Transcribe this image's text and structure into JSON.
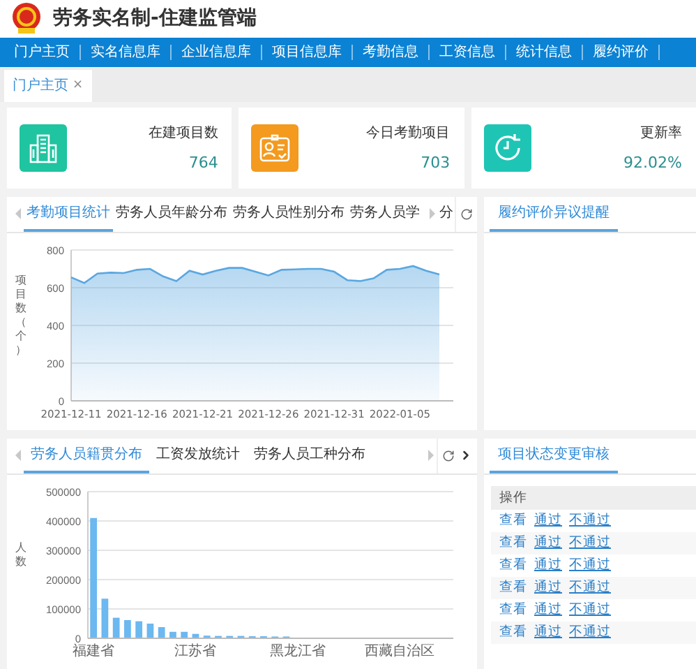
{
  "header": {
    "title": "劳务实名制-住建监管端"
  },
  "nav": [
    {
      "label": "门户主页"
    },
    {
      "label": "实名信息库"
    },
    {
      "label": "企业信息库"
    },
    {
      "label": "项目信息库"
    },
    {
      "label": "考勤信息"
    },
    {
      "label": "工资信息"
    },
    {
      "label": "统计信息"
    },
    {
      "label": "履约评价"
    }
  ],
  "page_tabs": [
    {
      "label": "门户主页",
      "close": "×",
      "selected": true
    }
  ],
  "stats": [
    {
      "kind": "building",
      "color": "#1fc4a0",
      "label": "在建项目数",
      "value": "764"
    },
    {
      "kind": "badge",
      "color": "#f39a1f",
      "label": "今日考勤项目",
      "value": "703"
    },
    {
      "kind": "refresh",
      "color": "#1ec5b4",
      "label": "更新率",
      "value": "92.02%"
    }
  ],
  "attendance_panel": {
    "tabs": [
      {
        "label": "考勤项目统计",
        "selected": true
      },
      {
        "label": "劳务人员年龄分布",
        "selected": false
      },
      {
        "label": "劳务人员性别分布",
        "selected": false
      },
      {
        "label": "劳务人员学",
        "selected": false
      }
    ],
    "clipped_tab": {
      "label": "分",
      "selected": false
    },
    "chart_data": {
      "type": "area",
      "ylabel": "项目数（个）",
      "ylim": [
        0,
        800
      ],
      "yticks": [
        0,
        200,
        400,
        600,
        800
      ],
      "grid": true,
      "categories": [
        "2021-12-11",
        null,
        null,
        null,
        null,
        "2021-12-16",
        null,
        null,
        null,
        null,
        "2021-12-21",
        null,
        null,
        null,
        null,
        "2021-12-26",
        null,
        null,
        null,
        null,
        "2021-12-31",
        null,
        null,
        null,
        null,
        "2022-01-05",
        null,
        null,
        null
      ],
      "series": [
        {
          "color": "#5aa7e0",
          "values": [
            655,
            625,
            675,
            680,
            678,
            695,
            700,
            660,
            635,
            690,
            670,
            690,
            705,
            705,
            685,
            665,
            695,
            697,
            700,
            700,
            685,
            640,
            635,
            650,
            695,
            700,
            715,
            690,
            670
          ]
        }
      ]
    }
  },
  "dispute_panel": {
    "title": "履约评价异议提醒"
  },
  "origin_panel": {
    "tabs": [
      {
        "label": "劳务人员籍贯分布",
        "selected": true
      },
      {
        "label": "工资发放统计",
        "selected": false
      },
      {
        "label": "劳务人员工种分布",
        "selected": false
      }
    ],
    "chart_data": {
      "type": "bar",
      "ylabel": "人数",
      "ylim": [
        0,
        500000
      ],
      "yticks": [
        0,
        100000,
        200000,
        300000,
        400000,
        500000
      ],
      "grid": true,
      "categories": [
        "福建省",
        null,
        null,
        null,
        null,
        null,
        null,
        null,
        null,
        "江苏省",
        null,
        null,
        null,
        null,
        null,
        null,
        null,
        null,
        "黑龙江省",
        null,
        null,
        null,
        null,
        null,
        null,
        null,
        null,
        "西藏自治区",
        null,
        null,
        null
      ],
      "series": [
        {
          "color": "#6cb8f0",
          "values": [
            410000,
            135000,
            70000,
            62000,
            58000,
            50000,
            38000,
            22000,
            22000,
            15000,
            9000,
            8000,
            8000,
            8000,
            7000,
            7000,
            6000,
            6000,
            null,
            null,
            null,
            null,
            null,
            null,
            null,
            null,
            null,
            null,
            null,
            null,
            null
          ]
        }
      ]
    }
  },
  "review_panel": {
    "title": "项目状态变更审核",
    "column": "操作",
    "rows": [
      [
        "查看",
        "通过",
        "不通过"
      ],
      [
        "查看",
        "通过",
        "不通过"
      ],
      [
        "查看",
        "通过",
        "不通过"
      ],
      [
        "查看",
        "通过",
        "不通过"
      ],
      [
        "查看",
        "通过",
        "不通过"
      ],
      [
        "查看",
        "通过",
        "不通过"
      ]
    ]
  }
}
